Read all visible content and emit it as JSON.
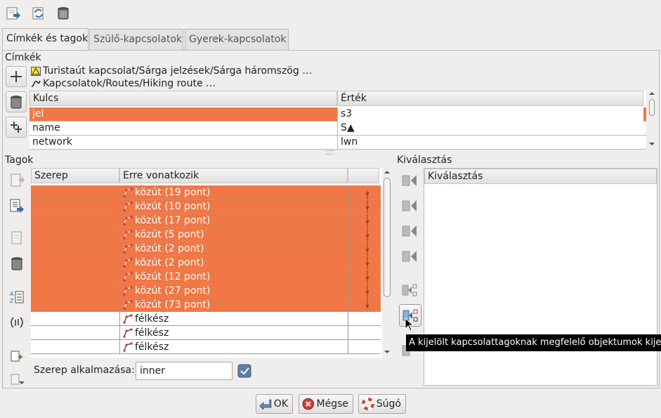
{
  "toolbar": {
    "icons": [
      "download-icon",
      "refresh-selection-icon",
      "trash-icon"
    ]
  },
  "tabs": [
    {
      "label": "Címkék és tagok",
      "active": true
    },
    {
      "label": "Szülő-kapcsolatok",
      "active": false
    },
    {
      "label": "Gyerek-kapcsolatok",
      "active": false
    }
  ],
  "tags_section": {
    "title": "Címkék",
    "preset_lines": [
      "Turistaút kapcsolat/Sárga jelzések/Sárga háromszög …",
      "Kapcsolatok/Routes/Hiking route …"
    ],
    "columns": [
      "Kulcs",
      "Érték"
    ],
    "rows": [
      {
        "key": "jel",
        "value": "s3",
        "selected": true
      },
      {
        "key": "name",
        "value": "S▲",
        "selected": false
      },
      {
        "key": "network",
        "value": "lwn",
        "selected": false
      }
    ]
  },
  "members_section": {
    "title": "Tagok",
    "columns": [
      "Szerep",
      "Erre vonatkozik",
      ""
    ],
    "rows": [
      {
        "role": "",
        "ref": "közút (19 pont)",
        "selected": true
      },
      {
        "role": "",
        "ref": "közút (10 pont)",
        "selected": true
      },
      {
        "role": "",
        "ref": "közút (17 pont)",
        "selected": true
      },
      {
        "role": "",
        "ref": "közút (5 pont)",
        "selected": true
      },
      {
        "role": "",
        "ref": "közút (2 pont)",
        "selected": true
      },
      {
        "role": "",
        "ref": "közút (2 pont)",
        "selected": true
      },
      {
        "role": "",
        "ref": "közút (12 pont)",
        "selected": true
      },
      {
        "role": "",
        "ref": "közút (27 pont)",
        "selected": true
      },
      {
        "role": "",
        "ref": "közút (73 pont)",
        "selected": true
      },
      {
        "role": "",
        "ref": "félkész",
        "selected": false
      },
      {
        "role": "",
        "ref": "félkész",
        "selected": false
      },
      {
        "role": "",
        "ref": "félkész",
        "selected": false
      }
    ],
    "role_label": "Szerep alkalmazása:",
    "role_value": "inner"
  },
  "selection_section": {
    "title": "Kiválasztás",
    "column": "Kiválasztás"
  },
  "tooltip": "A kijelölt kapcsolattagoknak megfelelő objektumok kijelölése",
  "buttons": {
    "ok": "OK",
    "cancel": "Mégse",
    "help": "Súgó"
  },
  "colors": {
    "selection": "#f07746",
    "accent_blue": "#3a6ea5",
    "route_line": "#d42a2a"
  }
}
